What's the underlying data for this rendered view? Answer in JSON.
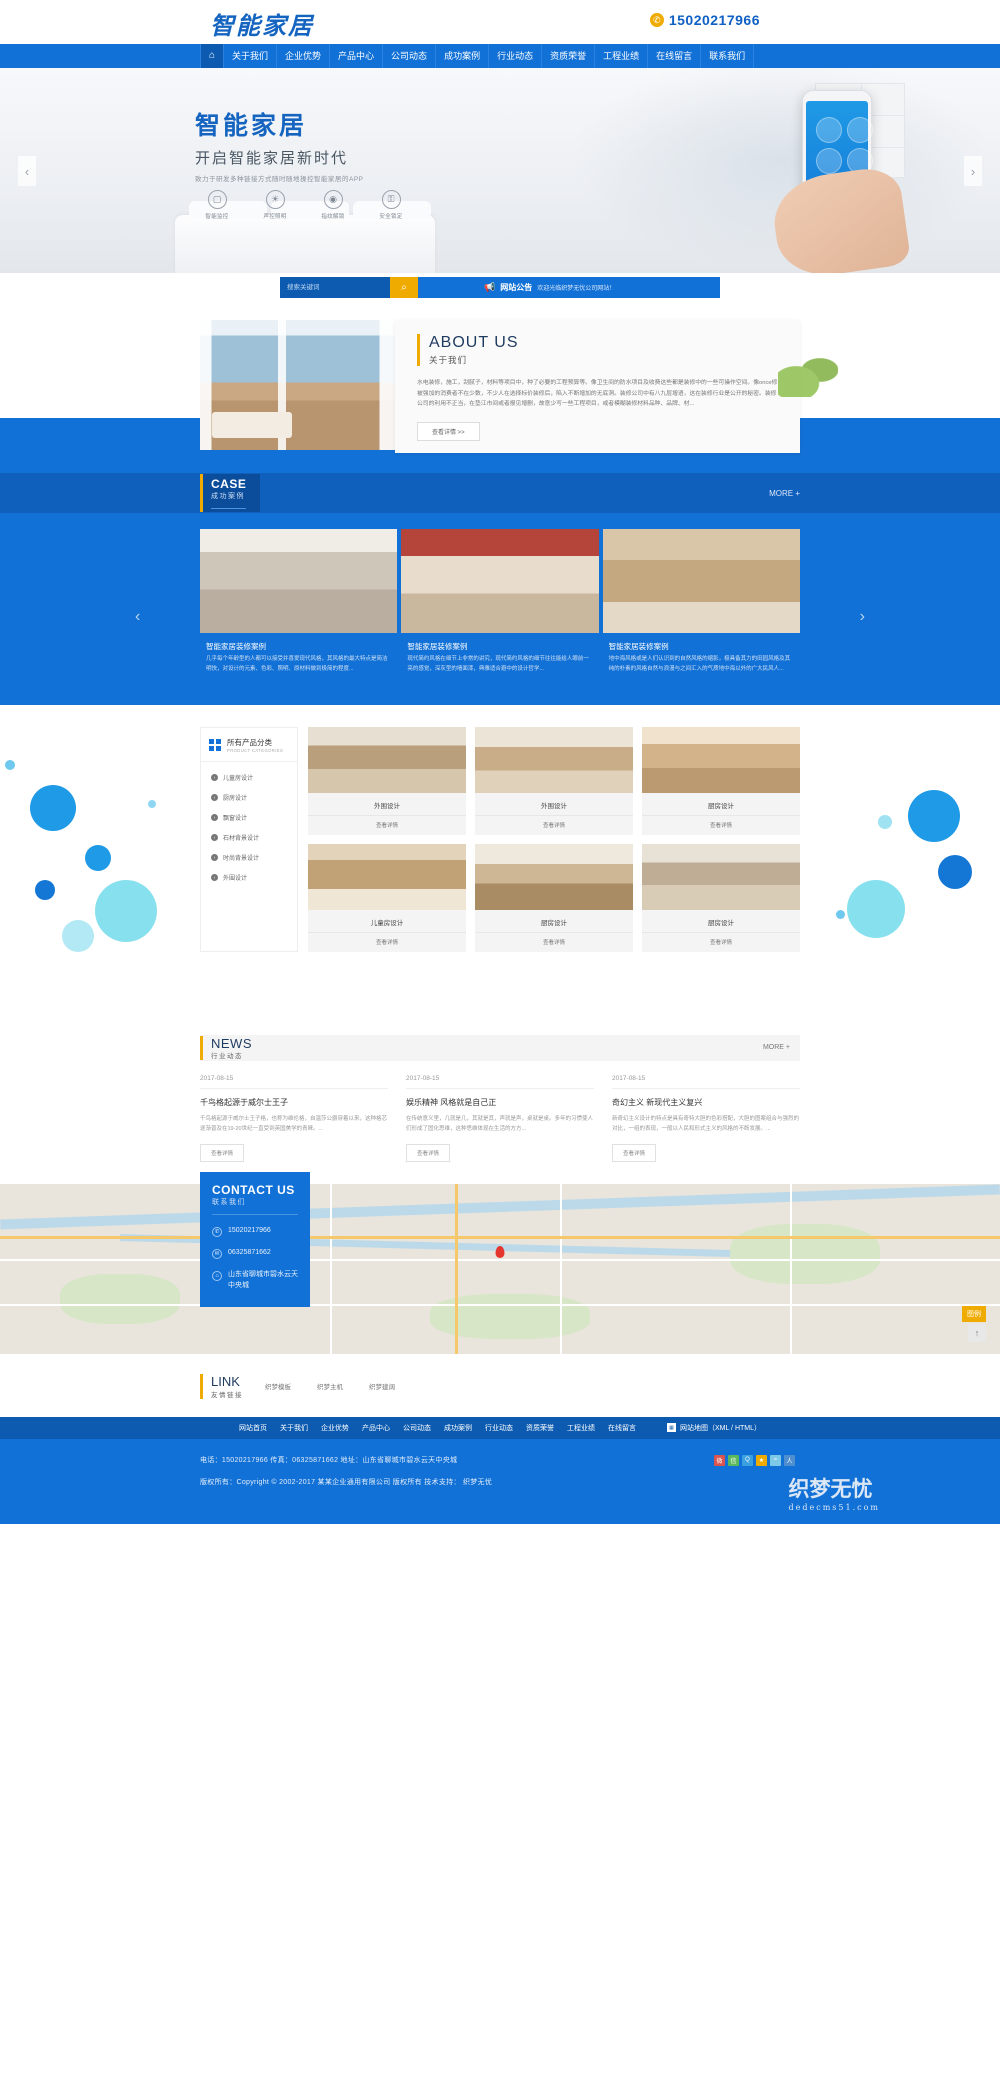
{
  "header": {
    "logo_text": "智能家居",
    "phone": "15020217966",
    "phone_icon": "phone-icon"
  },
  "nav": {
    "home_icon": "home-icon",
    "items": [
      {
        "label": "关于我们"
      },
      {
        "label": "企业优势"
      },
      {
        "label": "产品中心"
      },
      {
        "label": "公司动态"
      },
      {
        "label": "成功案例"
      },
      {
        "label": "行业动态"
      },
      {
        "label": "资质荣誉"
      },
      {
        "label": "工程业绩"
      },
      {
        "label": "在线留言"
      },
      {
        "label": "联系我们"
      }
    ]
  },
  "banner": {
    "title": "智能家居",
    "subtitle": "开启智能家居新时代",
    "tagline": "致力于研发多种链接方式随时随地操控智能家居的APP",
    "features": [
      {
        "label": "智能监控",
        "icon": "monitor-icon"
      },
      {
        "label": "声控照明",
        "icon": "lamp-icon"
      },
      {
        "label": "指纹解锁",
        "icon": "fingerprint-icon"
      },
      {
        "label": "安全锁定",
        "icon": "lock-icon"
      }
    ],
    "prev_icon": "chevron-left-icon",
    "next_icon": "chevron-right-icon"
  },
  "search": {
    "placeholder": "搜索关键词",
    "button_icon": "search-icon",
    "notice_icon": "megaphone-icon",
    "notice_label": "网站公告",
    "notice_text": "欢迎光临织梦无忧公司网站！"
  },
  "about": {
    "title_en": "ABOUT US",
    "title_cn": "关于我们",
    "body": "水电装修，施工，刮腻子，材料等项目中，种了必要的工程预算等。像卫生间的防水项目及收费这些都是装修中的一些可操作空间。像once修被强加的消费者不在少数，不少人在选择标价装修后，陷入不断增加的无底洞。装修公司中有八九层增语，这在装修行业是公开的秘密。装修公司的利用不正当，在垫江市间或者报见增删，故意少写一些工程项目，或者模糊装修材料品种、品牌、材...",
    "more_label": "查看详情 >>"
  },
  "case": {
    "title_en": "CASE",
    "title_cn": "成功案例",
    "more_label": "MORE +",
    "prev_icon": "chevron-left-icon",
    "next_icon": "chevron-right-icon",
    "items": [
      {
        "title": "智能家居装修案例",
        "desc": "几乎每个年龄型的人都可以接受并喜爱现代风格，其风格的最大特点是简洁明快，对设计的元素、色彩、照明、原材料做到极简的程度..."
      },
      {
        "title": "智能家居装修案例",
        "desc": "现代简约风格在细节上非常的讲究，现代简约风格的细节往往能给人眼前一亮的感觉，深灰型的墙面漆，典雅适合避中的设计哲学..."
      },
      {
        "title": "智能家居装修案例",
        "desc": "地中海风格或是人们认识到的自然风格的缩影，极具备其力的田园风格及其纯的朴素的风格自然与浪漫与之间汇入的气质地中海以外的广大民风人..."
      }
    ]
  },
  "products": {
    "sidebar": {
      "title_cn": "所有产品分类",
      "title_en": "PRODUCT CATEGORIES",
      "grid_icon": "grid-icon",
      "items": [
        {
          "label": "儿童房设计",
          "icon": "chevron-right-circle-icon"
        },
        {
          "label": "厨房设计",
          "icon": "chevron-right-circle-icon"
        },
        {
          "label": "飘窗设计",
          "icon": "chevron-right-circle-icon"
        },
        {
          "label": "石材背景设计",
          "icon": "chevron-right-circle-icon"
        },
        {
          "label": "时尚背景设计",
          "icon": "chevron-right-circle-icon"
        },
        {
          "label": "外围设计",
          "icon": "chevron-right-circle-icon"
        }
      ]
    },
    "items": [
      {
        "name": "外围设计",
        "btn": "查看详情"
      },
      {
        "name": "外围设计",
        "btn": "查看详情"
      },
      {
        "name": "厨房设计",
        "btn": "查看详情"
      },
      {
        "name": "儿童房设计",
        "btn": "查看详情"
      },
      {
        "name": "厨房设计",
        "btn": "查看详情"
      },
      {
        "name": "厨房设计",
        "btn": "查看详情"
      }
    ]
  },
  "news": {
    "title_en": "NEWS",
    "title_cn": "行业动态",
    "more_label": "MORE +",
    "items": [
      {
        "date": "2017-08-15",
        "title": "千鸟格起源于威尔士王子",
        "desc": "千鸟格起源于威尔士王子格，也称为维伦格，自温莎公爵穿着以来，这种格芯逐渐普及在19-20世纪一直受到英国美学的青睐。...",
        "btn": "查看详情"
      },
      {
        "date": "2017-08-15",
        "title": "娱乐精神 风格就是自己正",
        "desc": "在传统意义里，几就是几，其就是其，声就是声，桌就是桌。多年的习惯使人们形成了固化思维，这种思维体现在生活的方方...",
        "btn": "查看详情"
      },
      {
        "date": "2017-08-15",
        "title": "奇幻主义 新现代主义复兴",
        "desc": "新奇幻主义设计的特点是具有奇特大胆的色彩搭配，大胆的图案组合与强烈的对比，一组的表现，一般以人民和形式主义的风格的不断发展。...",
        "btn": "查看详情"
      }
    ]
  },
  "contact": {
    "title_en": "CONTACT US",
    "title_cn": "联系我们",
    "phone_icon": "phone-icon",
    "phone": "15020217966",
    "fax_icon": "fax-icon",
    "fax": "06325871662",
    "address_icon": "location-pin-icon",
    "address": "山东省聊城市碧水云天中央城",
    "map_badge": "图例",
    "to_top_icon": "arrow-up-icon"
  },
  "links": {
    "title_en": "LINK",
    "title_cn": "友情链接",
    "items": [
      {
        "label": "织梦模板"
      },
      {
        "label": "织梦主机"
      },
      {
        "label": "织梦建阔"
      }
    ]
  },
  "footer": {
    "nav": [
      {
        "label": "网站首页"
      },
      {
        "label": "关于我们"
      },
      {
        "label": "企业优势"
      },
      {
        "label": "产品中心"
      },
      {
        "label": "公司动态"
      },
      {
        "label": "成功案例"
      },
      {
        "label": "行业动态"
      },
      {
        "label": "资质荣誉"
      },
      {
        "label": "工程业绩"
      },
      {
        "label": "在线留言"
      }
    ],
    "sitemap_icon": "sitemap-icon",
    "sitemap_label": "网站地图（XML / HTML）",
    "contact_line": "电话：15020217966    传真：06325871662    地址：山东省聊城市碧水云天中央城",
    "copyright_line": "版权所有：Copyright © 2002-2017 某某企业通用有限公司 版权所有    技术支持： 织梦无忧",
    "social_icons": [
      "weibo-icon",
      "wechat-icon",
      "qq-icon",
      "star-icon",
      "rss-icon",
      "user-icon"
    ],
    "watermark": "织梦无忧",
    "watermark_sub": "dedecms51.com"
  },
  "colors": {
    "primary": "#1271d6",
    "primary_dark": "#0c5bb0",
    "accent": "#f0ab00",
    "deep": "#0f5fbd"
  }
}
